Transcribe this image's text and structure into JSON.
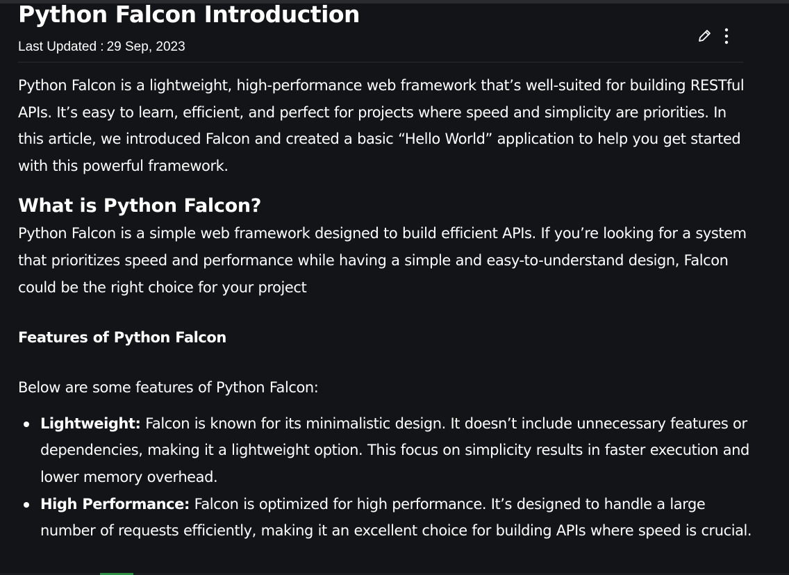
{
  "article": {
    "title": "Python Falcon Introduction",
    "updated_label": "Last Updated :",
    "updated_date": "29 Sep, 2023",
    "intro": "Python Falcon is a lightweight, high-performance web framework that’s well-suited for building RESTful APIs. It’s easy to learn, efficient, and perfect for projects where speed and simplicity are priorities. In this article, we introduced Falcon and created a basic “Hello World” application to help you get started with this powerful framework.",
    "section_heading": "What is Python Falcon?",
    "section_text": "Python Falcon is a simple web framework designed to build efficient APIs. If you’re looking for a system that prioritizes speed and performance while having a simple and easy-to-understand design, Falcon could be the right choice for your project",
    "features_heading": "Features of Python Falcon",
    "features_intro": "Below are some features of Python Falcon:",
    "features": [
      {
        "term": "Lightweight:",
        "text": " Falcon is known for its minimalistic design. It doesn’t include unnecessary features or dependencies, making it a lightweight option. This focus on simplicity results in faster execution and lower memory overhead."
      },
      {
        "term": "High Performance:",
        "text": " Falcon is optimized for high performance. It’s designed to handle a large number of requests efficiently, making it an excellent choice for building APIs where speed is crucial."
      }
    ]
  },
  "icons": {
    "edit": "pencil-icon",
    "more": "more-vertical-icon"
  },
  "colors": {
    "background": "#131417",
    "text": "#ffffff",
    "accent": "#2f8d46"
  }
}
